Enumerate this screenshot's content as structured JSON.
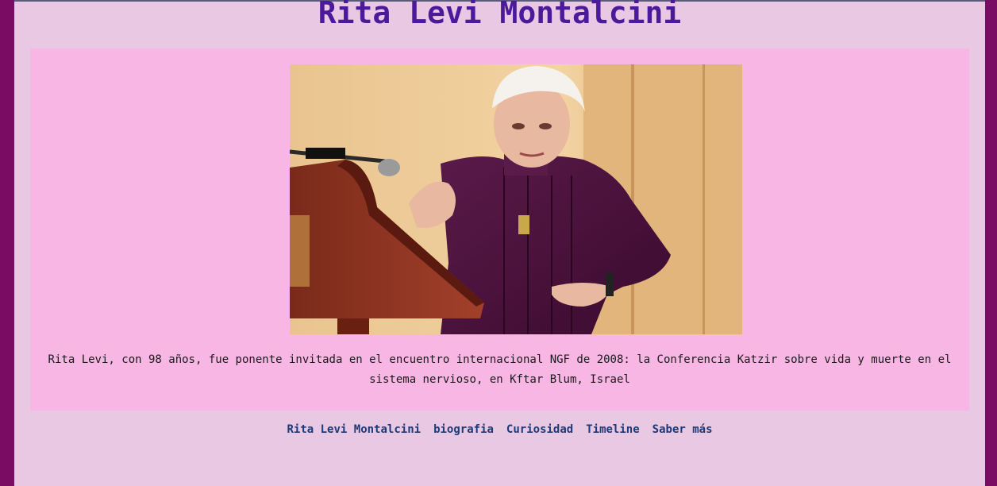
{
  "header": {
    "title": "Rita Levi Montalcini"
  },
  "figure": {
    "image_alt": "Rita Levi Montalcini speaking at a podium",
    "caption": "Rita Levi, con 98 años, fue ponente invitada en el encuentro internacional NGF de 2008: la Conferencia Katzir sobre vida y muerte en el sistema nervioso, en Kftar Blum, Israel"
  },
  "nav": {
    "items": [
      {
        "label": "Rita Levi Montalcini"
      },
      {
        "label": "biografia"
      },
      {
        "label": "Curiosidad"
      },
      {
        "label": "Timeline"
      },
      {
        "label": "Saber más"
      }
    ]
  },
  "colors": {
    "frame": "#7a0c63",
    "page_bg": "#e8c8e2",
    "card_bg": "#f8b6e4",
    "title": "#4a1a9a",
    "nav_link": "#1a3a7a"
  }
}
